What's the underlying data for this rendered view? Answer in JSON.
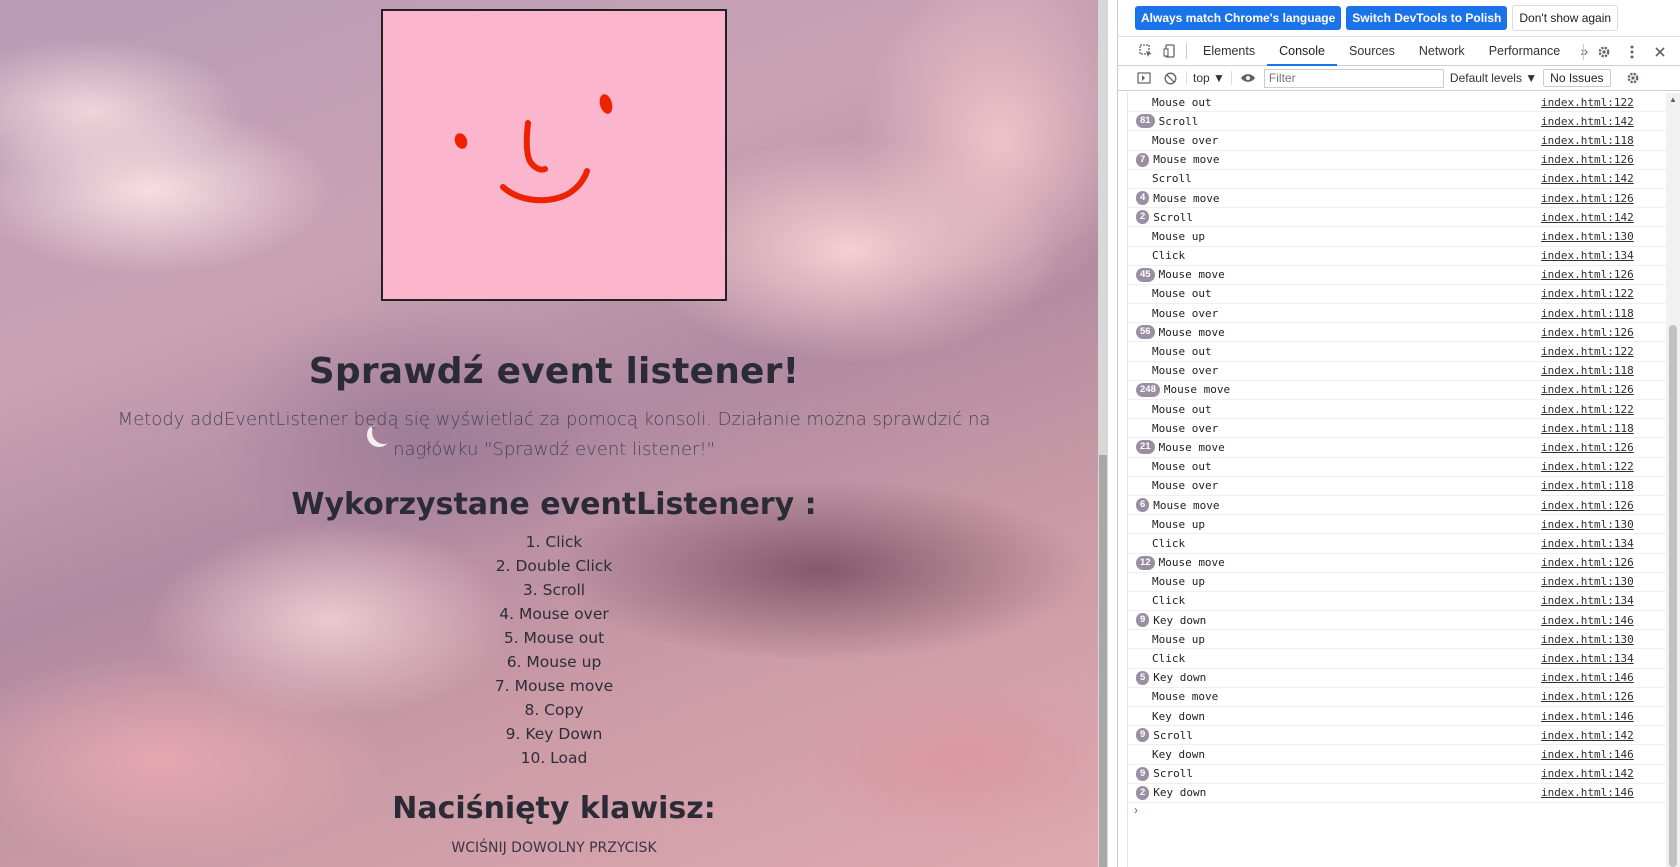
{
  "page": {
    "heading": "Sprawdź event listener!",
    "subtitle": "Metody addEventListener będą się wyświetlać za pomocą konsoli. Działanie można sprawdzić na nagłówku \"Sprawdź event listener!\"",
    "list_heading": "Wykorzystane eventListenery :",
    "events": [
      "1. Click",
      "2. Double Click",
      "3. Scroll",
      "4. Mouse over",
      "5. Mouse out",
      "6. Mouse up",
      "7. Mouse move",
      "8. Copy",
      "9. Key Down",
      "10. Load"
    ],
    "key_heading": "Naciśnięty klawisz:",
    "key_value": "wciśnij dowolny przycisk",
    "canvas_bg": "#fbb6cd",
    "drawing_color": "#ee2200"
  },
  "devtools": {
    "infobar": {
      "match_language": "Always match Chrome's language",
      "switch_language": "Switch DevTools to Polish",
      "dont_show": "Don't show again"
    },
    "tabs": [
      "Elements",
      "Console",
      "Sources",
      "Network",
      "Performance"
    ],
    "active_tab": "Console",
    "more_tabs": "»",
    "toolbar": {
      "context": "top ▼",
      "filter_placeholder": "Filter",
      "levels": "Default levels ▼",
      "issues": "No Issues"
    },
    "accent": "#1a73e8",
    "messages": [
      {
        "count": "",
        "text": "Mouse out",
        "src": "index.html:122"
      },
      {
        "count": "81",
        "text": "Scroll",
        "src": "index.html:142"
      },
      {
        "count": "",
        "text": "Mouse over",
        "src": "index.html:118"
      },
      {
        "count": "7",
        "text": "Mouse move",
        "src": "index.html:126"
      },
      {
        "count": "",
        "text": "Scroll",
        "src": "index.html:142"
      },
      {
        "count": "4",
        "text": "Mouse move",
        "src": "index.html:126"
      },
      {
        "count": "2",
        "text": "Scroll",
        "src": "index.html:142"
      },
      {
        "count": "",
        "text": "Mouse up",
        "src": "index.html:130"
      },
      {
        "count": "",
        "text": "Click",
        "src": "index.html:134"
      },
      {
        "count": "45",
        "text": "Mouse move",
        "src": "index.html:126"
      },
      {
        "count": "",
        "text": "Mouse out",
        "src": "index.html:122"
      },
      {
        "count": "",
        "text": "Mouse over",
        "src": "index.html:118"
      },
      {
        "count": "56",
        "text": "Mouse move",
        "src": "index.html:126"
      },
      {
        "count": "",
        "text": "Mouse out",
        "src": "index.html:122"
      },
      {
        "count": "",
        "text": "Mouse over",
        "src": "index.html:118"
      },
      {
        "count": "248",
        "text": "Mouse move",
        "src": "index.html:126"
      },
      {
        "count": "",
        "text": "Mouse out",
        "src": "index.html:122"
      },
      {
        "count": "",
        "text": "Mouse over",
        "src": "index.html:118"
      },
      {
        "count": "21",
        "text": "Mouse move",
        "src": "index.html:126"
      },
      {
        "count": "",
        "text": "Mouse out",
        "src": "index.html:122"
      },
      {
        "count": "",
        "text": "Mouse over",
        "src": "index.html:118"
      },
      {
        "count": "6",
        "text": "Mouse move",
        "src": "index.html:126"
      },
      {
        "count": "",
        "text": "Mouse up",
        "src": "index.html:130"
      },
      {
        "count": "",
        "text": "Click",
        "src": "index.html:134"
      },
      {
        "count": "12",
        "text": "Mouse move",
        "src": "index.html:126"
      },
      {
        "count": "",
        "text": "Mouse up",
        "src": "index.html:130"
      },
      {
        "count": "",
        "text": "Click",
        "src": "index.html:134"
      },
      {
        "count": "9",
        "text": "Key down",
        "src": "index.html:146"
      },
      {
        "count": "",
        "text": "Mouse up",
        "src": "index.html:130"
      },
      {
        "count": "",
        "text": "Click",
        "src": "index.html:134"
      },
      {
        "count": "5",
        "text": "Key down",
        "src": "index.html:146"
      },
      {
        "count": "",
        "text": "Mouse move",
        "src": "index.html:126"
      },
      {
        "count": "",
        "text": "Key down",
        "src": "index.html:146"
      },
      {
        "count": "9",
        "text": "Scroll",
        "src": "index.html:142"
      },
      {
        "count": "",
        "text": "Key down",
        "src": "index.html:146"
      },
      {
        "count": "9",
        "text": "Scroll",
        "src": "index.html:142"
      },
      {
        "count": "2",
        "text": "Key down",
        "src": "index.html:146"
      }
    ],
    "prompt": "›"
  }
}
